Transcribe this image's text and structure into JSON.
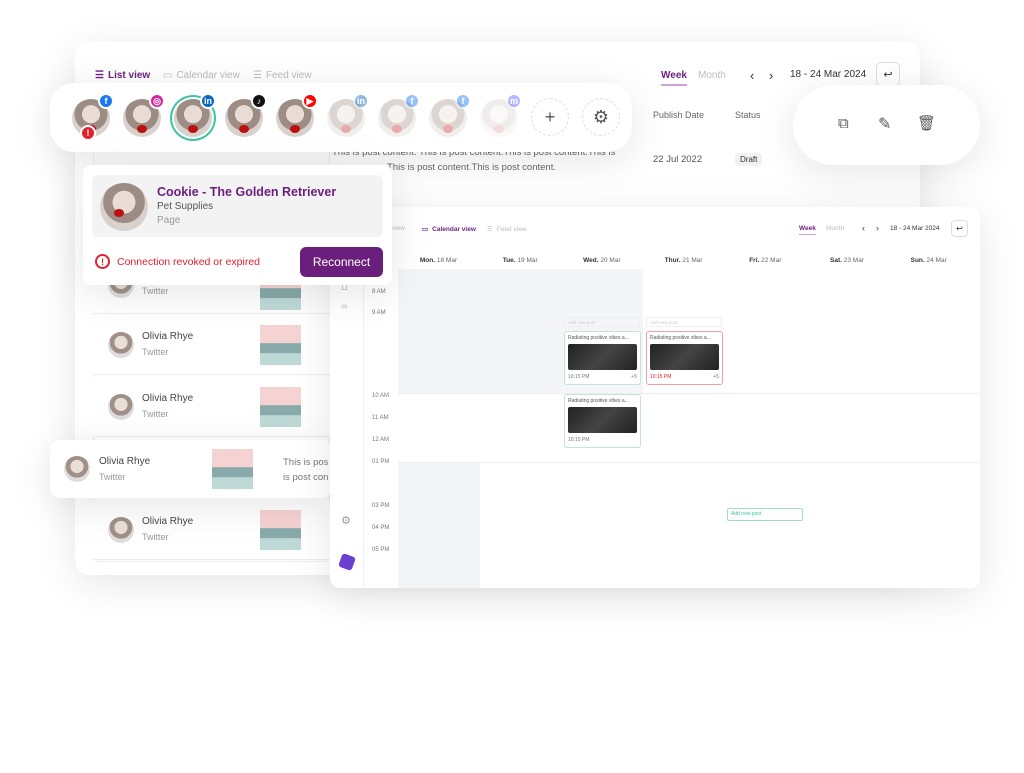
{
  "list_view": {
    "tabs": [
      "List view",
      "Calendar view",
      "Feed view"
    ],
    "period_tabs": [
      "Week",
      "Month"
    ],
    "date_range": "18 - 24 Mar 2024",
    "columns": {
      "publish_date": "Publish Date",
      "status": "Status"
    },
    "post_row": {
      "name": "Olivia Rhye",
      "content_line1": "This is post content. This is post content.This is post content.This is",
      "content_line2": "This is post content.This is post content.",
      "date": "22 Jul 2022",
      "status": "Draft"
    },
    "rows": [
      {
        "name": "Olivia Rhye",
        "network": "Twitter"
      },
      {
        "name": "Olivia Rhye",
        "network": "Twitter"
      },
      {
        "name": "Olivia Rhye",
        "network": "Twitter"
      },
      {
        "name": "Olivia Rhye",
        "network": "Twitter"
      }
    ],
    "floating_row": {
      "name": "Olivia Rhye",
      "network": "Twitter",
      "content_line1": "This is pos",
      "content_line2": "is post con"
    }
  },
  "accounts": [
    {
      "network": "facebook",
      "error": true
    },
    {
      "network": "instagram"
    },
    {
      "network": "linkedin",
      "selected": true
    },
    {
      "network": "tiktok"
    },
    {
      "network": "youtube"
    },
    {
      "network": "linkedin",
      "disabled": true
    },
    {
      "network": "facebook",
      "disabled": true
    },
    {
      "network": "facebook",
      "disabled": true
    },
    {
      "network": "mastodon",
      "disabled": true
    }
  ],
  "popup": {
    "title": "Cookie - The Golden Retriever",
    "category": "Pet Supplies",
    "type": "Page",
    "error": "Connection revoked or expired",
    "button": "Reconnect"
  },
  "actions": [
    "external-link-icon",
    "pencil-icon",
    "trash-icon"
  ],
  "calendar": {
    "tabs": [
      "List view",
      "Calendar view",
      "Feed view"
    ],
    "period_tabs": [
      "Week",
      "Month"
    ],
    "date_range": "18 - 24 Mar 2024",
    "days": [
      {
        "d": "Mon.",
        "n": "18 Mar"
      },
      {
        "d": "Tue.",
        "n": "19 Mar"
      },
      {
        "d": "Wed.",
        "n": "20 Mar"
      },
      {
        "d": "Thur.",
        "n": "21 Mar"
      },
      {
        "d": "Fri.",
        "n": "22 Mar"
      },
      {
        "d": "Sat.",
        "n": "23 Mar"
      },
      {
        "d": "Sun.",
        "n": "24 Mar"
      }
    ],
    "times": [
      "8 AM",
      "9 AM",
      "10 AM",
      "11 AM",
      "12 AM",
      "01 PM",
      "03 PM",
      "04 PM",
      "05 PM"
    ],
    "posts": [
      {
        "title": "Radiating positive vibes a...",
        "time": "10:15 PM",
        "more": "+5"
      },
      {
        "title": "Radiating positive vibes a...",
        "time": "10:15 PM",
        "more": "+5",
        "error": true
      },
      {
        "title": "Radiating positive vibes a...",
        "time": "10:15 PM",
        "more": ""
      }
    ],
    "add_post": "Add new post"
  },
  "colors": {
    "accent": "#6b1f7c",
    "error": "#e5202e",
    "teal": "#3cc4a4"
  }
}
